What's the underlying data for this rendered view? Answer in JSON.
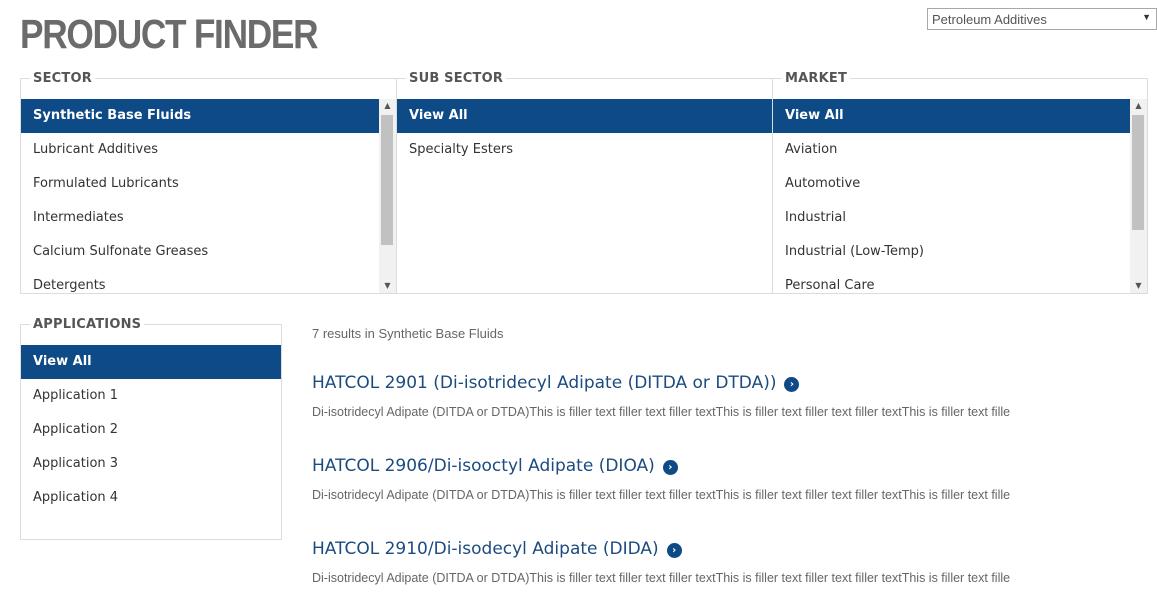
{
  "header": {
    "title": "PRODUCT FINDER",
    "division_select": {
      "selected": "Petroleum Additives",
      "caret_icon": "triangle-down"
    }
  },
  "sector": {
    "title": "SECTOR",
    "items": [
      "Synthetic Base Fluids",
      "Lubricant Additives",
      "Formulated Lubricants",
      "Intermediates",
      "Calcium Sulfonate Greases",
      "Detergents"
    ],
    "selected_index": 0
  },
  "sub_sector": {
    "title": "SUB SECTOR",
    "items": [
      "View All",
      "Specialty Esters"
    ],
    "selected_index": 0
  },
  "market": {
    "title": "MARKET",
    "items": [
      "View All",
      "Aviation",
      "Automotive",
      "Industrial",
      "Industrial (Low-Temp)",
      "Personal Care"
    ],
    "selected_index": 0
  },
  "applications": {
    "title": "APPLICATIONS",
    "items": [
      "View All",
      "Application 1",
      "Application 2",
      "Application 3",
      "Application 4"
    ],
    "selected_index": 0
  },
  "results": {
    "count_text": "7 results in Synthetic Base Fluids",
    "items": [
      {
        "title": "HATCOL 2901 (Di-isotridecyl Adipate (DITDA or DTDA))",
        "description": "Di-isotridecyl Adipate (DITDA or DTDA)This is filler text filler text filler textThis is filler text filler text filler textThis is filler text fille"
      },
      {
        "title": "HATCOL 2906/Di-isooctyl Adipate (DIOA)",
        "description": "Di-isotridecyl Adipate (DITDA or DTDA)This is filler text filler text filler textThis is filler text filler text filler textThis is filler text fille"
      },
      {
        "title": "HATCOL 2910/Di-isodecyl Adipate (DIDA)",
        "description": "Di-isotridecyl Adipate (DITDA or DTDA)This is filler text filler text filler textThis is filler text filler text filler textThis is filler text fille"
      }
    ]
  },
  "colors": {
    "selected_bg": "#0d4a86",
    "link": "#1c4b80",
    "title_gray": "#6b6b6b"
  }
}
